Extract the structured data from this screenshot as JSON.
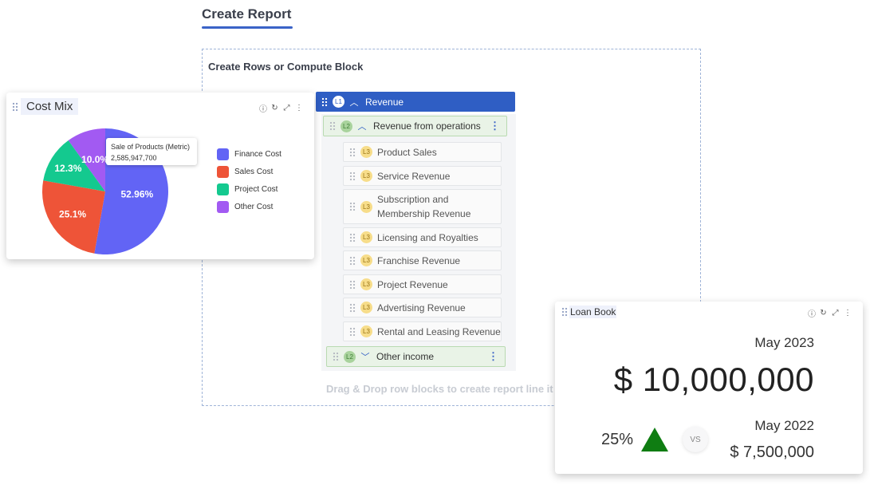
{
  "page": {
    "title": "Create Report"
  },
  "canvas": {
    "title": "Create Rows or Compute Block",
    "drop_hint": "Drag & Drop row blocks to create report line it"
  },
  "rows": {
    "l1": {
      "badge": "L1",
      "label": "Revenue"
    },
    "l2_operations": {
      "badge": "L2",
      "label": "Revenue from operations"
    },
    "l3_items": [
      {
        "badge": "L3",
        "label": "Product Sales"
      },
      {
        "badge": "L3",
        "label": "Service Revenue"
      },
      {
        "badge": "L3",
        "label": "Subscription and Membership Revenue"
      },
      {
        "badge": "L3",
        "label": "Licensing and Royalties"
      },
      {
        "badge": "L3",
        "label": "Franchise Revenue"
      },
      {
        "badge": "L3",
        "label": "Project Revenue"
      },
      {
        "badge": "L3",
        "label": "Advertising Revenue"
      },
      {
        "badge": "L3",
        "label": "Rental and Leasing Revenue"
      }
    ],
    "l2_other": {
      "badge": "L2",
      "label": "Other income"
    }
  },
  "cost_mix": {
    "title": "Cost Mix",
    "tooltip": {
      "label": "Sale of Products (Metric)",
      "value": "2,585,947,700"
    }
  },
  "chart_data": {
    "type": "pie",
    "title": "Cost Mix",
    "categories": [
      "Finance Cost",
      "Sales Cost",
      "Project Cost",
      "Other Cost"
    ],
    "values": [
      52.96,
      25.1,
      12.3,
      10.0
    ],
    "labels": [
      "52.96%",
      "25.1%",
      "12.3%",
      "10.0%"
    ],
    "colors": [
      "#6264f5",
      "#ee5438",
      "#14c98f",
      "#a25af2"
    ],
    "legend_position": "right"
  },
  "loan_book": {
    "title": "Loan Book",
    "current_date": "May 2023",
    "current_value": "$ 10,000,000",
    "change_pct": "25%",
    "vs_label": "VS",
    "prev_date": "May 2022",
    "prev_value": "$ 7,500,000",
    "trend_color": "#0f7d12"
  },
  "icons": [
    "drag-handle-icon",
    "info-icon",
    "refresh-icon",
    "expand-icon",
    "more-vertical-icon",
    "chevron-up-icon",
    "chevron-down-icon",
    "triangle-up-icon"
  ]
}
